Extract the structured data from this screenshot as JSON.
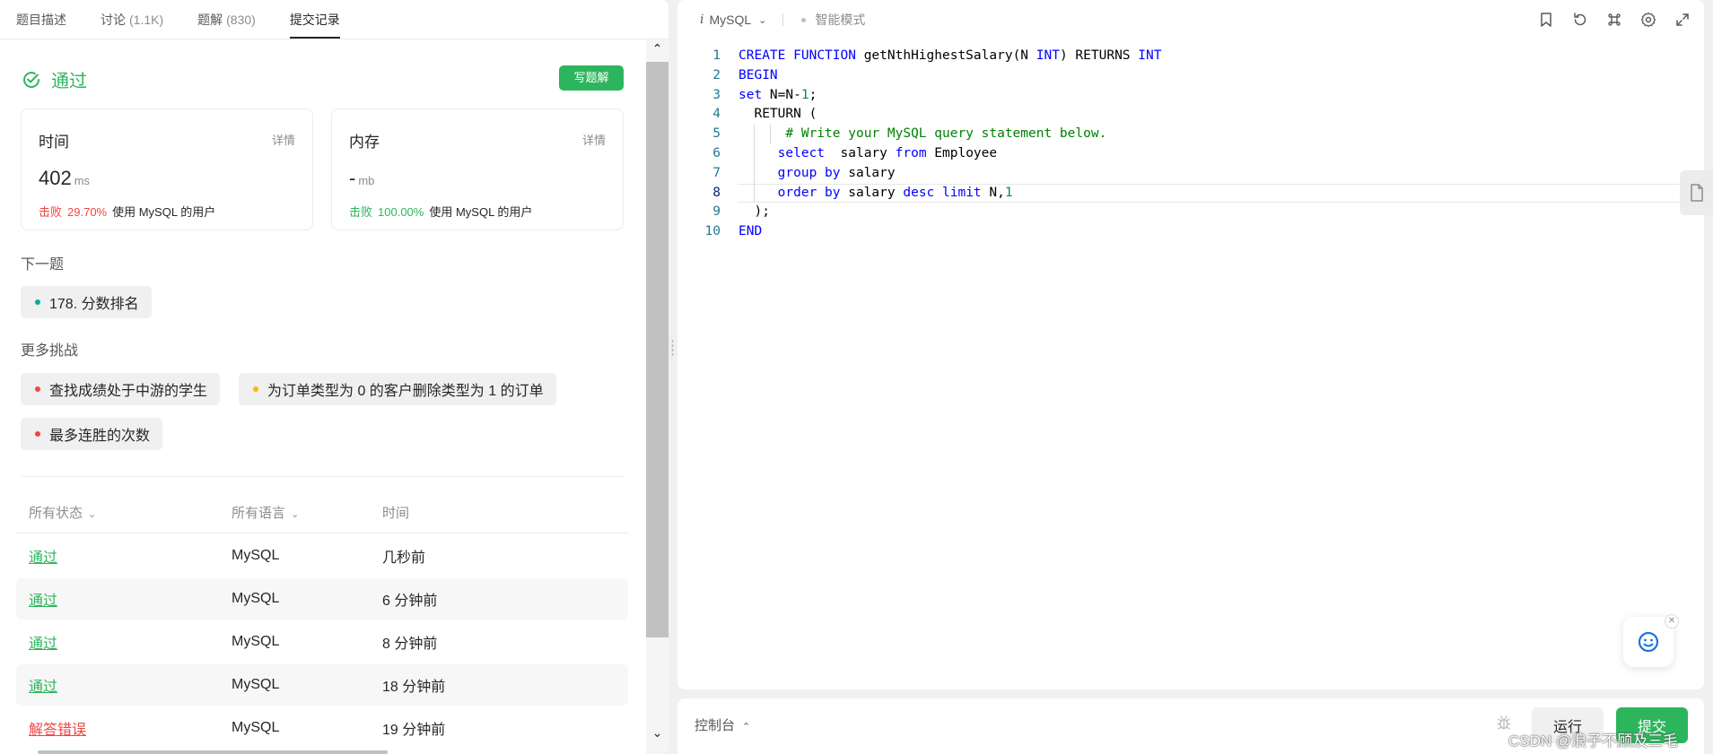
{
  "tabs": [
    {
      "label": "题目描述",
      "count": ""
    },
    {
      "label": "讨论",
      "count": "(1.1K)"
    },
    {
      "label": "题解",
      "count": "(830)"
    },
    {
      "label": "提交记录",
      "count": ""
    }
  ],
  "result": {
    "status": "通过",
    "write_solution": "写题解"
  },
  "time_card": {
    "title": "时间",
    "detail": "详情",
    "value": "402",
    "unit": "ms",
    "beat_label": "击败",
    "beat_pct": "29.70%",
    "beat_rest": "使用 MySQL 的用户"
  },
  "memory_card": {
    "title": "内存",
    "detail": "详情",
    "value": "-",
    "unit": "mb",
    "beat_label": "击败",
    "beat_pct": "100.00%",
    "beat_rest": "使用 MySQL 的用户"
  },
  "next": {
    "heading": "下一题",
    "item": "178. 分数排名"
  },
  "more": {
    "heading": "更多挑战",
    "items": [
      "查找成绩处于中游的学生",
      "为订单类型为 0 的客户删除类型为 1 的订单",
      "最多连胜的次数"
    ]
  },
  "table": {
    "headers": [
      "所有状态",
      "所有语言",
      "时间"
    ],
    "rows": [
      {
        "status": "通过",
        "lang": "MySQL",
        "time": "几秒前"
      },
      {
        "status": "通过",
        "lang": "MySQL",
        "time": "6 分钟前"
      },
      {
        "status": "通过",
        "lang": "MySQL",
        "time": "8 分钟前"
      },
      {
        "status": "通过",
        "lang": "MySQL",
        "time": "18 分钟前"
      },
      {
        "status": "解答错误",
        "lang": "MySQL",
        "time": "19 分钟前"
      }
    ]
  },
  "editor": {
    "language": "MySQL",
    "smart_mode": "智能模式",
    "lines": [
      "1",
      "2",
      "3",
      "4",
      "5",
      "6",
      "7",
      "8",
      "9",
      "10"
    ]
  },
  "console": {
    "label": "控制台",
    "run": "运行",
    "submit": "提交"
  },
  "watermark": "CSDN @浪子不顾及三毛",
  "colors": {
    "accent_green": "#2db55d",
    "error_red": "#ef4743"
  }
}
